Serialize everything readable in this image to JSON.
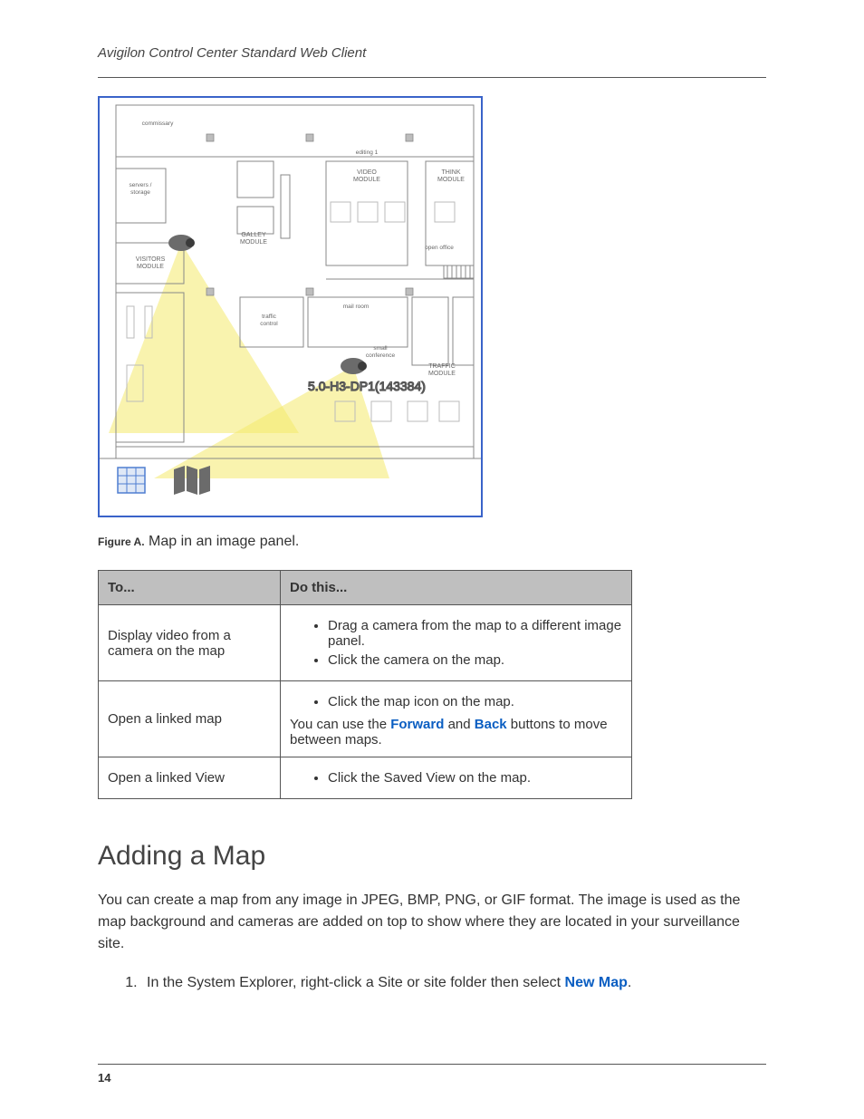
{
  "header": {
    "running_title": "Avigilon Control Center Standard Web Client"
  },
  "figure": {
    "label": "Figure A.",
    "caption": "Map in an image panel.",
    "device_label": "5.0-H3-DP1(143384)",
    "rooms": {
      "commissary": "commissary",
      "servers_storage": "servers /\nstorage",
      "gallery_module": "GALLEY\nMODULE",
      "visitors_module": "VISITORS\nMODULE",
      "video_module": "VIDEO\nMODULE",
      "think_module": "THINK\nMODULE",
      "open_office": "open office",
      "traffic_control": "traffic\ncontrol",
      "mail_room": "mail room",
      "small_conference": "small\nconference",
      "traffic_module": "TRAFFIC\nMODULE",
      "editing1": "editing 1"
    }
  },
  "table": {
    "head": {
      "c1": "To...",
      "c2": "Do this..."
    },
    "rows": [
      {
        "c1": "Display video from a camera on the map",
        "items": [
          "Drag a camera from the map to a different image panel.",
          "Click the camera on the map."
        ]
      },
      {
        "c1": "Open a linked map",
        "items": [
          "Click the map icon on the map."
        ],
        "para_before": "You can use the ",
        "para_kw1": "Forward",
        "para_mid": " and ",
        "para_kw2": "Back",
        "para_after": " buttons to move between maps."
      },
      {
        "c1": "Open a linked View",
        "items": [
          "Click the Saved View on the map."
        ]
      }
    ]
  },
  "section": {
    "heading": "Adding a Map"
  },
  "para1": "You can create a map from any image in JPEG, BMP, PNG, or GIF format. The image is used as the map background and cameras are added on top to show where they are located in your surveillance site.",
  "step1_before": "In the System Explorer, right-click a Site or site folder then select ",
  "step1_kw": "New Map",
  "step1_after": ".",
  "page_number": "14"
}
